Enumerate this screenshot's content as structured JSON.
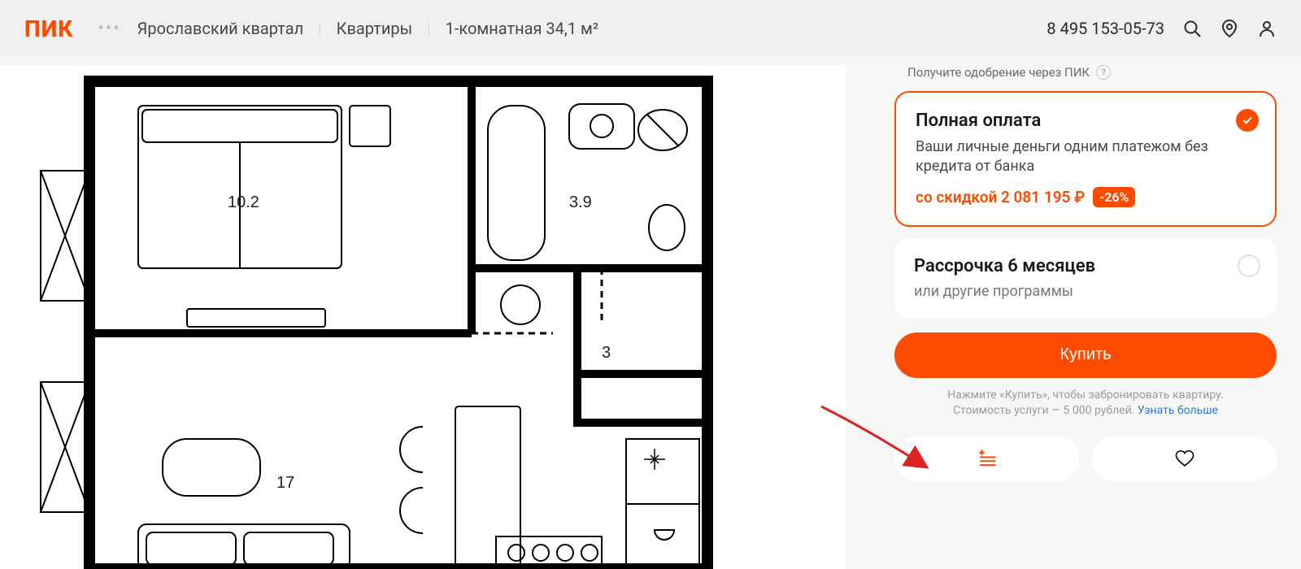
{
  "header": {
    "logo": "ПИК",
    "breadcrumb": {
      "project": "Ярославский квартал",
      "section": "Квартиры",
      "unit": "1-комнатная 34,1 м²"
    },
    "phone": "8 495 153-05-73"
  },
  "floorplan": {
    "rooms": {
      "bedroom": "10.2",
      "bathroom": "3.9",
      "hall": "3",
      "living": "17"
    }
  },
  "side": {
    "approval_hint": "Получите одобрение через ПИК",
    "option_full": {
      "title": "Полная оплата",
      "subtitle": "Ваши личные деньги одним платежом без кредита от банка",
      "discount_label": "со скидкой 2 081 195 ₽",
      "discount_badge": "-26%"
    },
    "option_installment": {
      "title": "Рассрочка 6 месяцев",
      "subtitle": "или другие программы"
    },
    "buy_label": "Купить",
    "buy_hint_1": "Нажмите «Купить», чтобы забронировать квартиру.",
    "buy_hint_2": "Стоимость услуги — 5 000 рублей. ",
    "buy_hint_link": "Узнать больше"
  }
}
